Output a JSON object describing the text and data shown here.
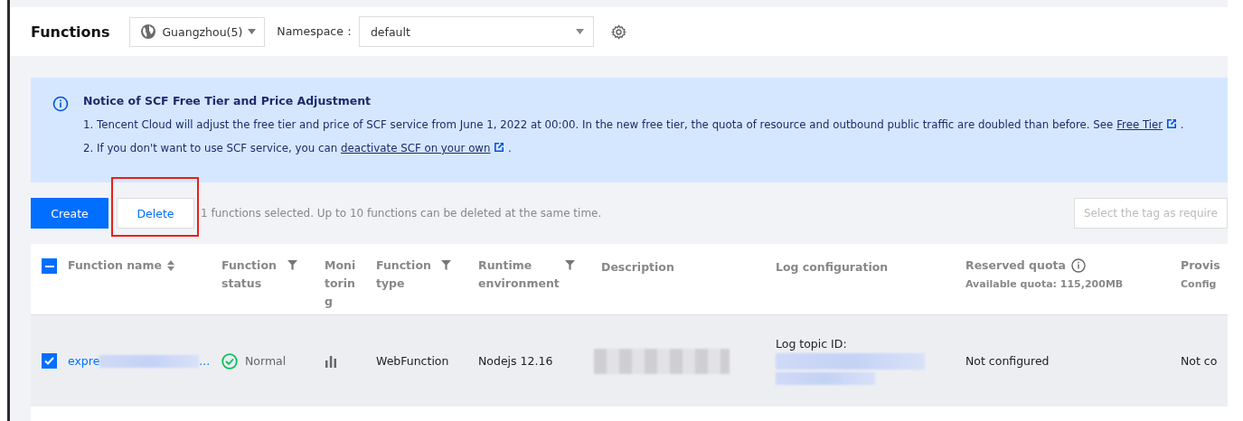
{
  "header": {
    "title": "Functions",
    "region": "Guangzhou(5)",
    "namespace_label": "Namespace：",
    "namespace": "default"
  },
  "notice": {
    "title": "Notice of SCF Free Tier and Price Adjustment",
    "lines": [
      {
        "text": "1. Tencent Cloud will adjust the free tier and price of SCF service from June 1, 2022 at 00:00. In the new free tier, the quota of resource and outbound public traffic are doubled than before. See ",
        "link": "Free Tier",
        "end": "."
      },
      {
        "text": "2. If you don't want to use SCF service, you can ",
        "link": "deactivate SCF on your own",
        "end": "."
      }
    ]
  },
  "toolbar": {
    "create": "Create",
    "delete": "Delete",
    "delete_highlighted": true,
    "hint": "1 functions selected. Up to 10 functions can be deleted at the same time.",
    "tag_placeholder": "Select the tag as require"
  },
  "table": {
    "select_all_indeterminate": true,
    "columns": [
      {
        "label": "Function name",
        "kind": "sort"
      },
      {
        "label": "Function status",
        "kind": "filter"
      },
      {
        "label": "Monitoring",
        "kind": "plain"
      },
      {
        "label": "Function type",
        "kind": "filter"
      },
      {
        "label": "Runtime environment",
        "kind": "filter"
      },
      {
        "label": "Description",
        "kind": "plain"
      },
      {
        "label": "Log configuration",
        "kind": "plain"
      },
      {
        "label": "Reserved quota",
        "kind": "info",
        "sub": "Available quota: 115,200MB"
      },
      {
        "label": "Provis",
        "kind": "plain",
        "sub": "Config"
      }
    ],
    "rows": [
      {
        "checked": true,
        "name_start": "expre",
        "name_end": "...",
        "status": "Normal",
        "type": "WebFunction",
        "runtime": "Nodejs 12.16",
        "log_label": "Log topic ID:",
        "reserved": "Not configured",
        "provisioned": "Not co"
      }
    ]
  }
}
